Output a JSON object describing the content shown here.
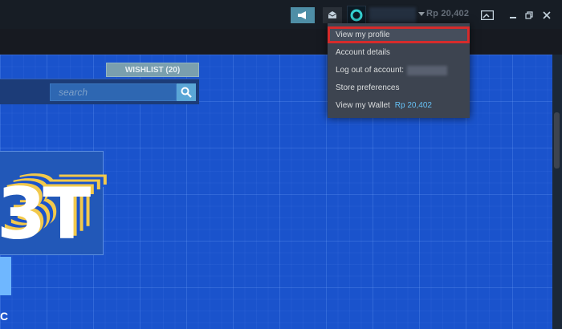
{
  "header": {
    "balance": "Rp 20,402"
  },
  "store": {
    "wishlist_label": "WISHLIST (20)",
    "search_placeholder": "search",
    "banner_text": "3T",
    "banner_letter": "C"
  },
  "account_menu": {
    "items": [
      {
        "label": "View my profile"
      },
      {
        "label": "Account details"
      },
      {
        "label": "Log out of account:"
      },
      {
        "label": "Store preferences"
      },
      {
        "label": "View my Wallet",
        "value": "Rp 20,402"
      }
    ]
  },
  "colors": {
    "highlight": "#d62b2b",
    "store_bg": "#1a53cc",
    "wallet_accent": "#66c0f4"
  },
  "icons": [
    "megaphone-icon",
    "envelope-icon",
    "avatar-ring-icon",
    "caret-down-icon",
    "screenshot-icon",
    "minimize-icon",
    "maximize-icon",
    "close-icon",
    "search-icon"
  ]
}
